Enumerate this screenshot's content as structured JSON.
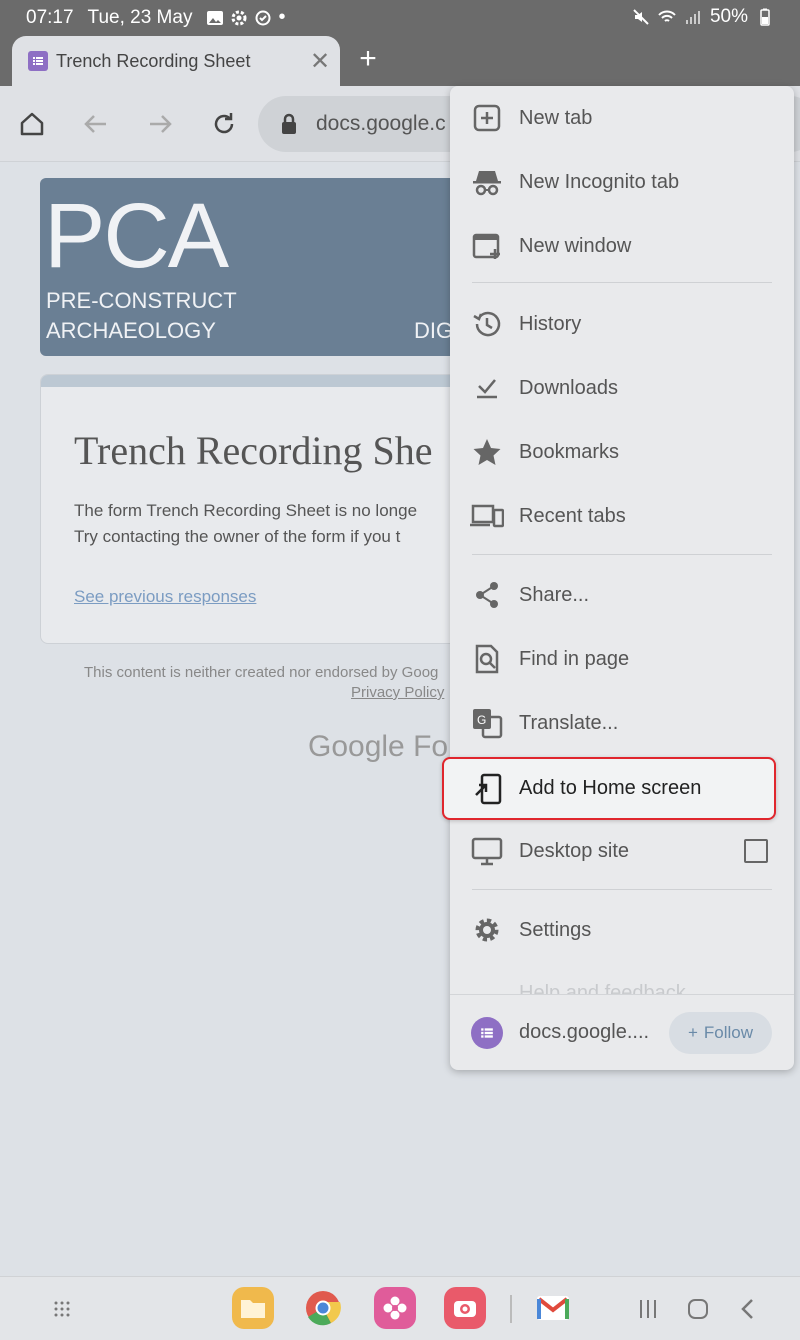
{
  "status_bar": {
    "time": "07:17",
    "date": "Tue, 23 May",
    "battery": "50%",
    "icons": [
      "gallery-icon",
      "settings-icon",
      "sync-icon",
      "dot-icon",
      "mute-icon",
      "wifi-icon",
      "signal-icon",
      "battery-icon"
    ]
  },
  "tab": {
    "title": "Trench Recording Sheet",
    "close_glyph": "✕",
    "new_tab_glyph": "+"
  },
  "toolbar": {
    "url": "docs.google.c"
  },
  "page": {
    "banner": {
      "logo": "PCA",
      "line1": "PRE-CONSTRUCT",
      "line2": "ARCHAEOLOGY",
      "right_text": "DIG"
    },
    "form_title": "Trench Recording She",
    "message_line1": "The form Trench Recording Sheet is no longe",
    "message_line2": "Try contacting the owner of the form if you t",
    "previous_link": "See previous responses",
    "disclaimer": "This content is neither created nor endorsed by Goog",
    "privacy": "Privacy Policy",
    "google_forms": "Google For"
  },
  "menu": {
    "items": [
      {
        "label": "New tab",
        "icon": "new-tab-icon"
      },
      {
        "label": "New Incognito tab",
        "icon": "incognito-icon"
      },
      {
        "label": "New window",
        "icon": "new-window-icon"
      },
      {
        "label": "History",
        "icon": "history-icon"
      },
      {
        "label": "Downloads",
        "icon": "downloads-icon"
      },
      {
        "label": "Bookmarks",
        "icon": "star-icon"
      },
      {
        "label": "Recent tabs",
        "icon": "devices-icon"
      },
      {
        "label": "Share...",
        "icon": "share-icon"
      },
      {
        "label": "Find in page",
        "icon": "find-icon"
      },
      {
        "label": "Translate...",
        "icon": "translate-icon"
      },
      {
        "label": "Add to Home screen",
        "icon": "add-to-home-icon"
      },
      {
        "label": "Desktop site",
        "icon": "desktop-icon"
      },
      {
        "label": "Settings",
        "icon": "gear-icon"
      }
    ],
    "faded_item": "Help and feedback",
    "footer_site": "docs.google....",
    "follow_label": "Follow",
    "highlight_color": "#e0262d"
  },
  "nav_bar": {
    "apps": [
      "files-icon",
      "chrome-icon",
      "flower-icon",
      "camera-icon",
      "gmail-icon"
    ]
  }
}
